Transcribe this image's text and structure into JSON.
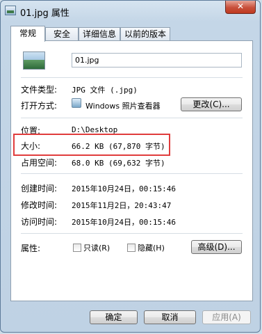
{
  "window": {
    "title": "01.jpg 属性",
    "close_glyph": "✕"
  },
  "tabs": [
    {
      "label": "常规",
      "active": true
    },
    {
      "label": "安全",
      "active": false
    },
    {
      "label": "详细信息",
      "active": false
    },
    {
      "label": "以前的版本",
      "active": false
    }
  ],
  "general": {
    "filename": "01.jpg",
    "file_type_label": "文件类型:",
    "file_type_value": "JPG 文件 (.jpg)",
    "opens_with_label": "打开方式:",
    "opens_with_value": "Windows 照片查看器",
    "change_button": "更改(C)...",
    "location_label": "位置:",
    "location_value": "D:\\Desktop",
    "size_label": "大小:",
    "size_value": "66.2 KB (67,870 字节)",
    "size_on_disk_label": "占用空间:",
    "size_on_disk_value": "68.0 KB (69,632 字节)",
    "created_label": "创建时间:",
    "created_value": "2015年10月24日，00:15:46",
    "modified_label": "修改时间:",
    "modified_value": "2015年11月2日，20:43:47",
    "accessed_label": "访问时间:",
    "accessed_value": "2015年10月24日，00:15:46",
    "attributes_label": "属性:",
    "readonly_label": "只读(R)",
    "hidden_label": "隐藏(H)",
    "advanced_button": "高级(D)..."
  },
  "footer": {
    "ok": "确定",
    "cancel": "取消",
    "apply": "应用(A)"
  },
  "colors": {
    "highlight_box": "#e03c3c",
    "close_button": "#c8503b"
  }
}
